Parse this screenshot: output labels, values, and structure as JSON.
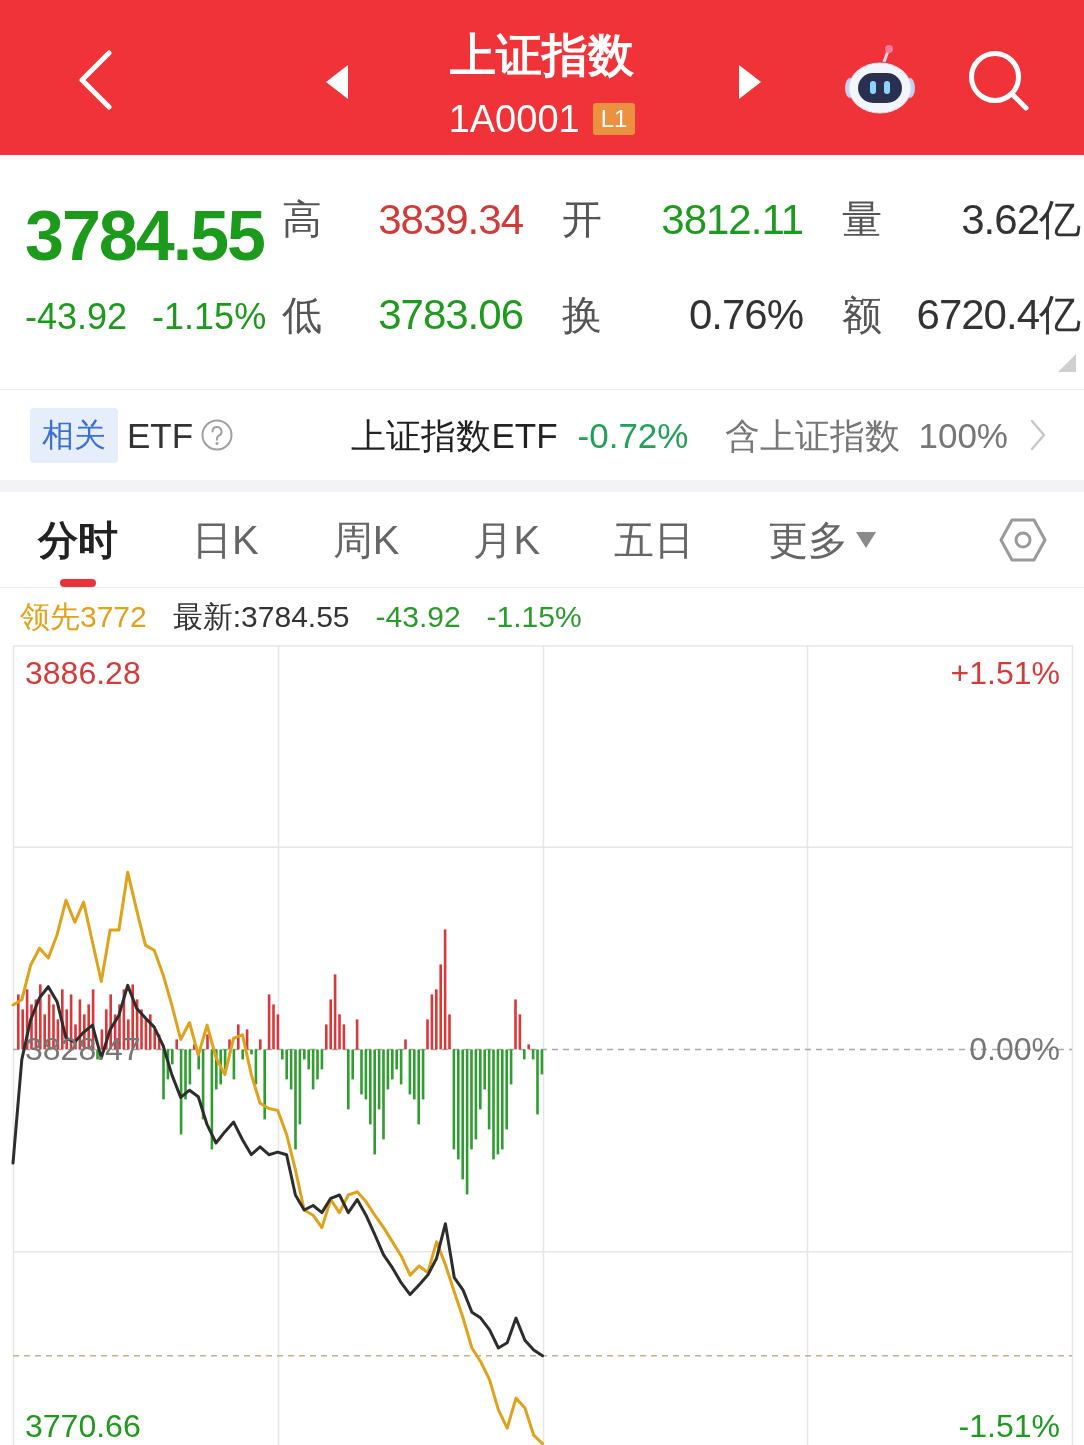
{
  "header": {
    "title": "上证指数",
    "code": "1A0001",
    "badge": "L1"
  },
  "quote": {
    "price": "3784.55",
    "change": "-43.92",
    "change_percent": "-1.15%",
    "stats": [
      {
        "label": "高",
        "value": "3839.34",
        "color": "#d23a3a"
      },
      {
        "label": "开",
        "value": "3812.11",
        "color": "#1e9a1e"
      },
      {
        "label": "量",
        "value": "3.62亿",
        "color": "#333333"
      },
      {
        "label": "低",
        "value": "3783.06",
        "color": "#1e9a1e"
      },
      {
        "label": "换",
        "value": "0.76%",
        "color": "#333333"
      },
      {
        "label": "额",
        "value": "6720.4亿",
        "color": "#333333"
      }
    ]
  },
  "related_etf": {
    "tag": "相关",
    "label": "ETF",
    "name": "上证指数ETF",
    "change": "-0.72%",
    "holding_label": "含上证指数",
    "holding_percent": "100%"
  },
  "tabs": [
    {
      "label": "分时",
      "selected": true,
      "kind": "tab"
    },
    {
      "label": "日K",
      "selected": false,
      "kind": "tab"
    },
    {
      "label": "周K",
      "selected": false,
      "kind": "tab"
    },
    {
      "label": "月K",
      "selected": false,
      "kind": "tab"
    },
    {
      "label": "五日",
      "selected": false,
      "kind": "tab"
    },
    {
      "label": "更多",
      "selected": false,
      "kind": "dropdown"
    }
  ],
  "legend": {
    "series_readings": [
      "3772",
      ":3784.55"
    ],
    "change": "-43.92",
    "change_percent": "-1.15%"
  },
  "chart": {
    "right_axis_labels": [
      "+1.51%",
      "0.00%",
      "-1.51%"
    ],
    "chart_data": {
      "type": "line",
      "categories": [
        null,
        null,
        null,
        null,
        null,
        null,
        null,
        null,
        null,
        null,
        null,
        null,
        null,
        null,
        null,
        null,
        null,
        null,
        null,
        null,
        null,
        null,
        null,
        null,
        null,
        null,
        null,
        null,
        null,
        null,
        null,
        null,
        null,
        null,
        null,
        null,
        null,
        null,
        null,
        null,
        null,
        null,
        null,
        null,
        null,
        null,
        null,
        null,
        null,
        null,
        null,
        null,
        null,
        null,
        null,
        null,
        null,
        null,
        null,
        null,
        null,
        null,
        null,
        null,
        null,
        null,
        null,
        null,
        null,
        null,
        null,
        null,
        null,
        null,
        null,
        null,
        null,
        null,
        null,
        null,
        null,
        null,
        null,
        null,
        null,
        null,
        null,
        null,
        null,
        null,
        null,
        null,
        null,
        null,
        null,
        null,
        null,
        null,
        null,
        null,
        null,
        null,
        null,
        null,
        null,
        null,
        null,
        null,
        null,
        null,
        null,
        null,
        null,
        null,
        null,
        null,
        null,
        null,
        null,
        null,
        null
      ],
      "ylim": [
        3767.7,
        3890.6
      ],
      "yticks": [
        {
          "value": 3886.28,
          "label": "3886.28"
        },
        {
          "value": 3828.47,
          "label": "3828.47"
        },
        {
          "value": 3770.66,
          "label": "3770.66"
        }
      ],
      "ref_lines": [
        {
          "axis": "y",
          "value": 3828.47,
          "color": "#a8a8a8"
        },
        {
          "axis": "y",
          "value": 3781.4,
          "color": "#bfb38a"
        }
      ],
      "series": [
        {
          "name": "领先",
          "color": "#e0a11b",
          "values": [
            3835.3,
            3836.1,
            3841.4,
            3844.0,
            3842.5,
            3846.1,
            3851.4,
            3848.0,
            3851.1,
            3845.0,
            3838.9,
            3846.8,
            3846.8,
            3855.7,
            3849.9,
            3844.5,
            3843.7,
            3840.0,
            3835.3,
            3830.0,
            3832.6,
            3827.6,
            3832.2,
            3827.2,
            3824.6,
            3830.2,
            3830.7,
            3824.6,
            3820.2,
            3819.4,
            3819.1,
            3815.4,
            3810.0,
            3803.8,
            3803.0,
            3801.1,
            3805.4,
            3803.4,
            3806.1,
            3806.6,
            3805.1,
            3803.0,
            3801.1,
            3798.9,
            3796.7,
            3793.8,
            3795.2,
            3794.2,
            3798.9,
            3795.4,
            3791.2,
            3787.2,
            3782.6,
            3780.5,
            3777.7,
            3773.1,
            3770.3,
            3774.9,
            3773.4,
            3769.2,
            3767.9,
            null,
            null,
            null,
            null,
            null,
            null,
            null,
            null,
            null,
            null,
            null,
            null,
            null,
            null,
            null,
            null,
            null,
            null,
            null,
            null,
            null,
            null,
            null,
            null,
            null,
            null,
            null,
            null,
            null,
            null,
            null,
            null,
            null,
            null,
            null,
            null,
            null,
            null,
            null,
            null,
            null,
            null,
            null,
            null,
            null,
            null,
            null,
            null,
            null,
            null,
            null,
            null,
            null,
            null,
            null,
            null,
            null,
            null,
            null,
            null
          ]
        },
        {
          "name": "最新",
          "color": "#2d2d2d",
          "values": [
            3811.0,
            3826.9,
            3833.0,
            3836.4,
            3838.1,
            3835.8,
            3830.2,
            3829.6,
            3831.1,
            3832.2,
            3827.2,
            3831.5,
            3833.7,
            3838.3,
            3834.8,
            3833.3,
            3831.9,
            3829.1,
            3824.6,
            3821.1,
            3822.2,
            3821.2,
            3816.9,
            3814.1,
            3815.8,
            3817.3,
            3814.6,
            3812.3,
            3813.5,
            3812.3,
            3812.7,
            3812.3,
            3806.1,
            3803.8,
            3804.5,
            3803.4,
            3805.6,
            3806.1,
            3803.4,
            3805.4,
            3803.0,
            3800.0,
            3796.9,
            3794.9,
            3792.6,
            3790.8,
            3792.3,
            3793.8,
            3796.4,
            3801.7,
            3793.4,
            3791.5,
            3788.1,
            3787.2,
            3785.4,
            3782.6,
            3783.4,
            3787.2,
            3783.8,
            3782.3,
            3781.4,
            null,
            null,
            null,
            null,
            null,
            null,
            null,
            null,
            null,
            null,
            null,
            null,
            null,
            null,
            null,
            null,
            null,
            null,
            null,
            null,
            null,
            null,
            null,
            null,
            null,
            null,
            null,
            null,
            null,
            null,
            null,
            null,
            null,
            null,
            null,
            null,
            null,
            null,
            null,
            null,
            null,
            null,
            null,
            null,
            null,
            null,
            null,
            null,
            null,
            null,
            null,
            null,
            null,
            null,
            null,
            null,
            null,
            null,
            null,
            null
          ]
        }
      ]
    }
  }
}
